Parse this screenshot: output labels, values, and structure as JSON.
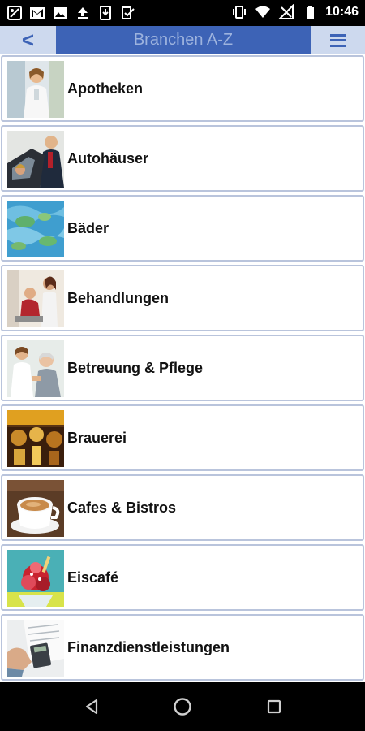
{
  "status_bar": {
    "time": "10:46",
    "left_icons": [
      "share-icon",
      "gmail-icon",
      "image-icon",
      "upload-icon",
      "download-icon",
      "done-icon"
    ],
    "right_icons": [
      "vibrate-icon",
      "wifi-icon",
      "no-signal-icon",
      "battery-icon"
    ]
  },
  "header": {
    "back_label": "<",
    "title": "Branchen A-Z",
    "menu_icon": "hamburger-menu-icon"
  },
  "list": {
    "items": [
      {
        "label": "Apotheken",
        "thumb": "pharmacist-photo"
      },
      {
        "label": "Autohäuser",
        "thumb": "car-dealer-photo"
      },
      {
        "label": "Bäder",
        "thumb": "pool-water-photo"
      },
      {
        "label": "Behandlungen",
        "thumb": "treatment-photo"
      },
      {
        "label": "Betreuung & Pflege",
        "thumb": "nursing-care-photo"
      },
      {
        "label": "Brauerei",
        "thumb": "brewery-photo"
      },
      {
        "label": "Cafes & Bistros",
        "thumb": "coffee-cup-photo"
      },
      {
        "label": "Eiscafé",
        "thumb": "ice-cream-photo"
      },
      {
        "label": "Finanzdienstleistungen",
        "thumb": "finance-calculator-photo"
      }
    ]
  },
  "nav_bar": {
    "buttons": [
      "back-triangle-icon",
      "home-circle-icon",
      "recents-square-icon"
    ]
  },
  "colors": {
    "header_blue": "#3d63b6",
    "button_light_blue": "#cdd9ee",
    "title_text": "#9db3de",
    "item_border": "#b9c4dc"
  }
}
